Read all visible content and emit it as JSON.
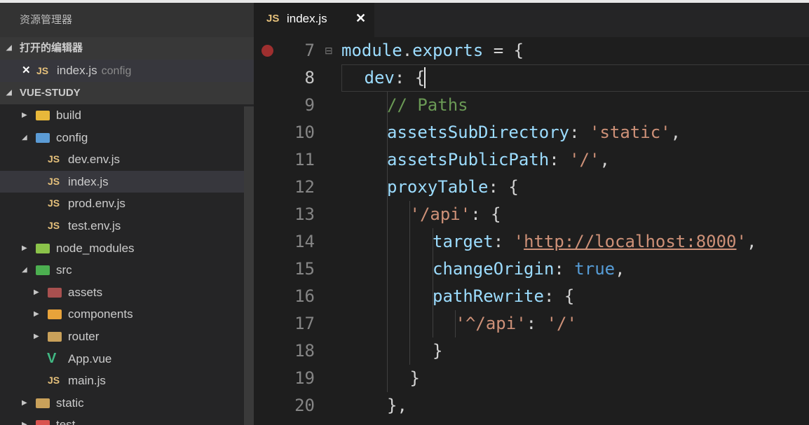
{
  "sidebar": {
    "title": "资源管理器",
    "open_editors": {
      "label": "打开的编辑器",
      "items": [
        {
          "close": "✕",
          "lang": "JS",
          "name": "index.js",
          "desc": "config"
        }
      ]
    },
    "project": {
      "label": "VUE-STUDY",
      "tree": [
        {
          "label": "build",
          "kind": "folder",
          "expanded": false,
          "icon_color": "#e8b83a"
        },
        {
          "label": "config",
          "kind": "folder",
          "expanded": true,
          "icon_color": "#5b9bd5"
        },
        {
          "label": "dev.env.js",
          "kind": "js"
        },
        {
          "label": "index.js",
          "kind": "js",
          "selected": true
        },
        {
          "label": "prod.env.js",
          "kind": "js"
        },
        {
          "label": "test.env.js",
          "kind": "js"
        },
        {
          "label": "node_modules",
          "kind": "folder",
          "expanded": false,
          "icon_color": "#8bc34a"
        },
        {
          "label": "src",
          "kind": "folder",
          "expanded": true,
          "icon_color": "#4caf50"
        },
        {
          "label": "assets",
          "kind": "folder",
          "expanded": false,
          "icon_color": "#a8504f"
        },
        {
          "label": "components",
          "kind": "folder",
          "expanded": false,
          "icon_color": "#e8a33a"
        },
        {
          "label": "router",
          "kind": "folder",
          "expanded": false,
          "icon_color": "#c9a15a"
        },
        {
          "label": "App.vue",
          "kind": "vue"
        },
        {
          "label": "main.js",
          "kind": "js"
        },
        {
          "label": "static",
          "kind": "folder",
          "expanded": false,
          "icon_color": "#c9a15a"
        },
        {
          "label": "test",
          "kind": "folder",
          "expanded": false,
          "icon_color": "#d9534f"
        }
      ]
    }
  },
  "editor": {
    "tab": {
      "lang": "JS",
      "name": "index.js",
      "close": "✕"
    },
    "fold_icon": "⊟",
    "lines": [
      {
        "n": "7",
        "tokens": [
          [
            "k",
            "module"
          ],
          [
            "p",
            "."
          ],
          [
            "k",
            "exports"
          ],
          [
            "p",
            " = {"
          ]
        ]
      },
      {
        "n": "8",
        "tokens": [
          [
            "k",
            "dev"
          ],
          [
            "p",
            ": {"
          ]
        ]
      },
      {
        "n": "9",
        "tokens": [
          [
            "c",
            "// Paths"
          ]
        ]
      },
      {
        "n": "10",
        "tokens": [
          [
            "k",
            "assetsSubDirectory"
          ],
          [
            "p",
            ": "
          ],
          [
            "s",
            "'static'"
          ],
          [
            "p",
            ","
          ]
        ]
      },
      {
        "n": "11",
        "tokens": [
          [
            "k",
            "assetsPublicPath"
          ],
          [
            "p",
            ": "
          ],
          [
            "s",
            "'/'"
          ],
          [
            "p",
            ","
          ]
        ]
      },
      {
        "n": "12",
        "tokens": [
          [
            "k",
            "proxyTable"
          ],
          [
            "p",
            ": {"
          ]
        ]
      },
      {
        "n": "13",
        "tokens": [
          [
            "s",
            "'/api'"
          ],
          [
            "p",
            ": {"
          ]
        ]
      },
      {
        "n": "14",
        "tokens": [
          [
            "k",
            "target"
          ],
          [
            "p",
            ": "
          ],
          [
            "s",
            "'"
          ],
          [
            "su",
            "http://localhost:8000"
          ],
          [
            "s",
            "'"
          ],
          [
            "p",
            ","
          ]
        ]
      },
      {
        "n": "15",
        "tokens": [
          [
            "k",
            "changeOrigin"
          ],
          [
            "p",
            ": "
          ],
          [
            "b",
            "true"
          ],
          [
            "p",
            ","
          ]
        ]
      },
      {
        "n": "16",
        "tokens": [
          [
            "k",
            "pathRewrite"
          ],
          [
            "p",
            ": {"
          ]
        ]
      },
      {
        "n": "17",
        "tokens": [
          [
            "s",
            "'^/api'"
          ],
          [
            "p",
            ": "
          ],
          [
            "s",
            "'/'"
          ]
        ]
      },
      {
        "n": "18",
        "tokens": [
          [
            "p",
            "}"
          ]
        ]
      },
      {
        "n": "19",
        "tokens": [
          [
            "p",
            "}"
          ]
        ]
      },
      {
        "n": "20",
        "tokens": [
          [
            "p",
            "},"
          ]
        ]
      }
    ]
  }
}
